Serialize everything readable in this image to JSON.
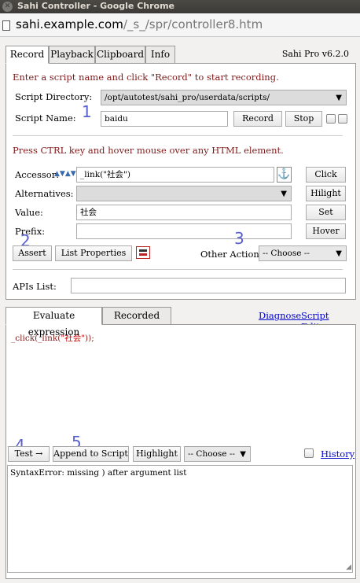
{
  "window": {
    "title": "Sahi Controller - Google Chrome"
  },
  "urlbar": {
    "host": "sahi.example.com",
    "path": "/_s_/spr/controller8.htm"
  },
  "tabs": [
    {
      "label": "Record",
      "active": true
    },
    {
      "label": "Playback",
      "active": false
    },
    {
      "label": "Clipboard",
      "active": false
    },
    {
      "label": "Info",
      "active": false
    }
  ],
  "version": "Sahi Pro v6.2.0",
  "record": {
    "instruction": "Enter a script name and click \"Record\" to start recording.",
    "script_directory_label": "Script Directory:",
    "script_directory_value": "/opt/autotest/sahi_pro/userdata/scripts/",
    "script_name_label": "Script Name:",
    "script_name_value": "baidu",
    "record_button": "Record",
    "stop_button": "Stop",
    "hover_instruction": "Press CTRL key and hover mouse over any HTML element.",
    "accessor_label": "Accessor:",
    "accessor_value": "_link(\"社会\")",
    "click_button": "Click",
    "alternatives_label": "Alternatives:",
    "alternatives_value": "",
    "hilight_button": "Hilight",
    "value_label": "Value:",
    "value_value": "社会",
    "set_button": "Set",
    "prefix_label": "Prefix:",
    "prefix_value": "",
    "hover_button": "Hover",
    "assert_button": "Assert",
    "list_properties_button": "List Properties",
    "other_actions_label": "Other Actions:",
    "other_actions_value": "-- Choose --",
    "apis_list_label": "APIs List:",
    "apis_list_value": ""
  },
  "bottom_tabs": [
    {
      "label": "Evaluate expression",
      "active": true
    },
    {
      "label": "Recorded steps",
      "active": false
    }
  ],
  "links": {
    "diagnose": "Diagnose",
    "script_editor": "Script Editor",
    "history": "History"
  },
  "evaluate": {
    "code_prefix": "_click(_link(",
    "code_string": "\"社会\"",
    "code_suffix": "));",
    "test_button": "Test →",
    "append_button": "Append to Script",
    "highlight_button": "Highlight",
    "choose_value": "-- Choose --",
    "result": "SyntaxError: missing ) after argument list"
  },
  "annotations": [
    "1",
    "2",
    "3",
    "4",
    "5"
  ],
  "colors": {
    "instruction_red": "#7f1a1a",
    "link_blue": "#0000cc",
    "annotation": "#5a5fd0"
  }
}
